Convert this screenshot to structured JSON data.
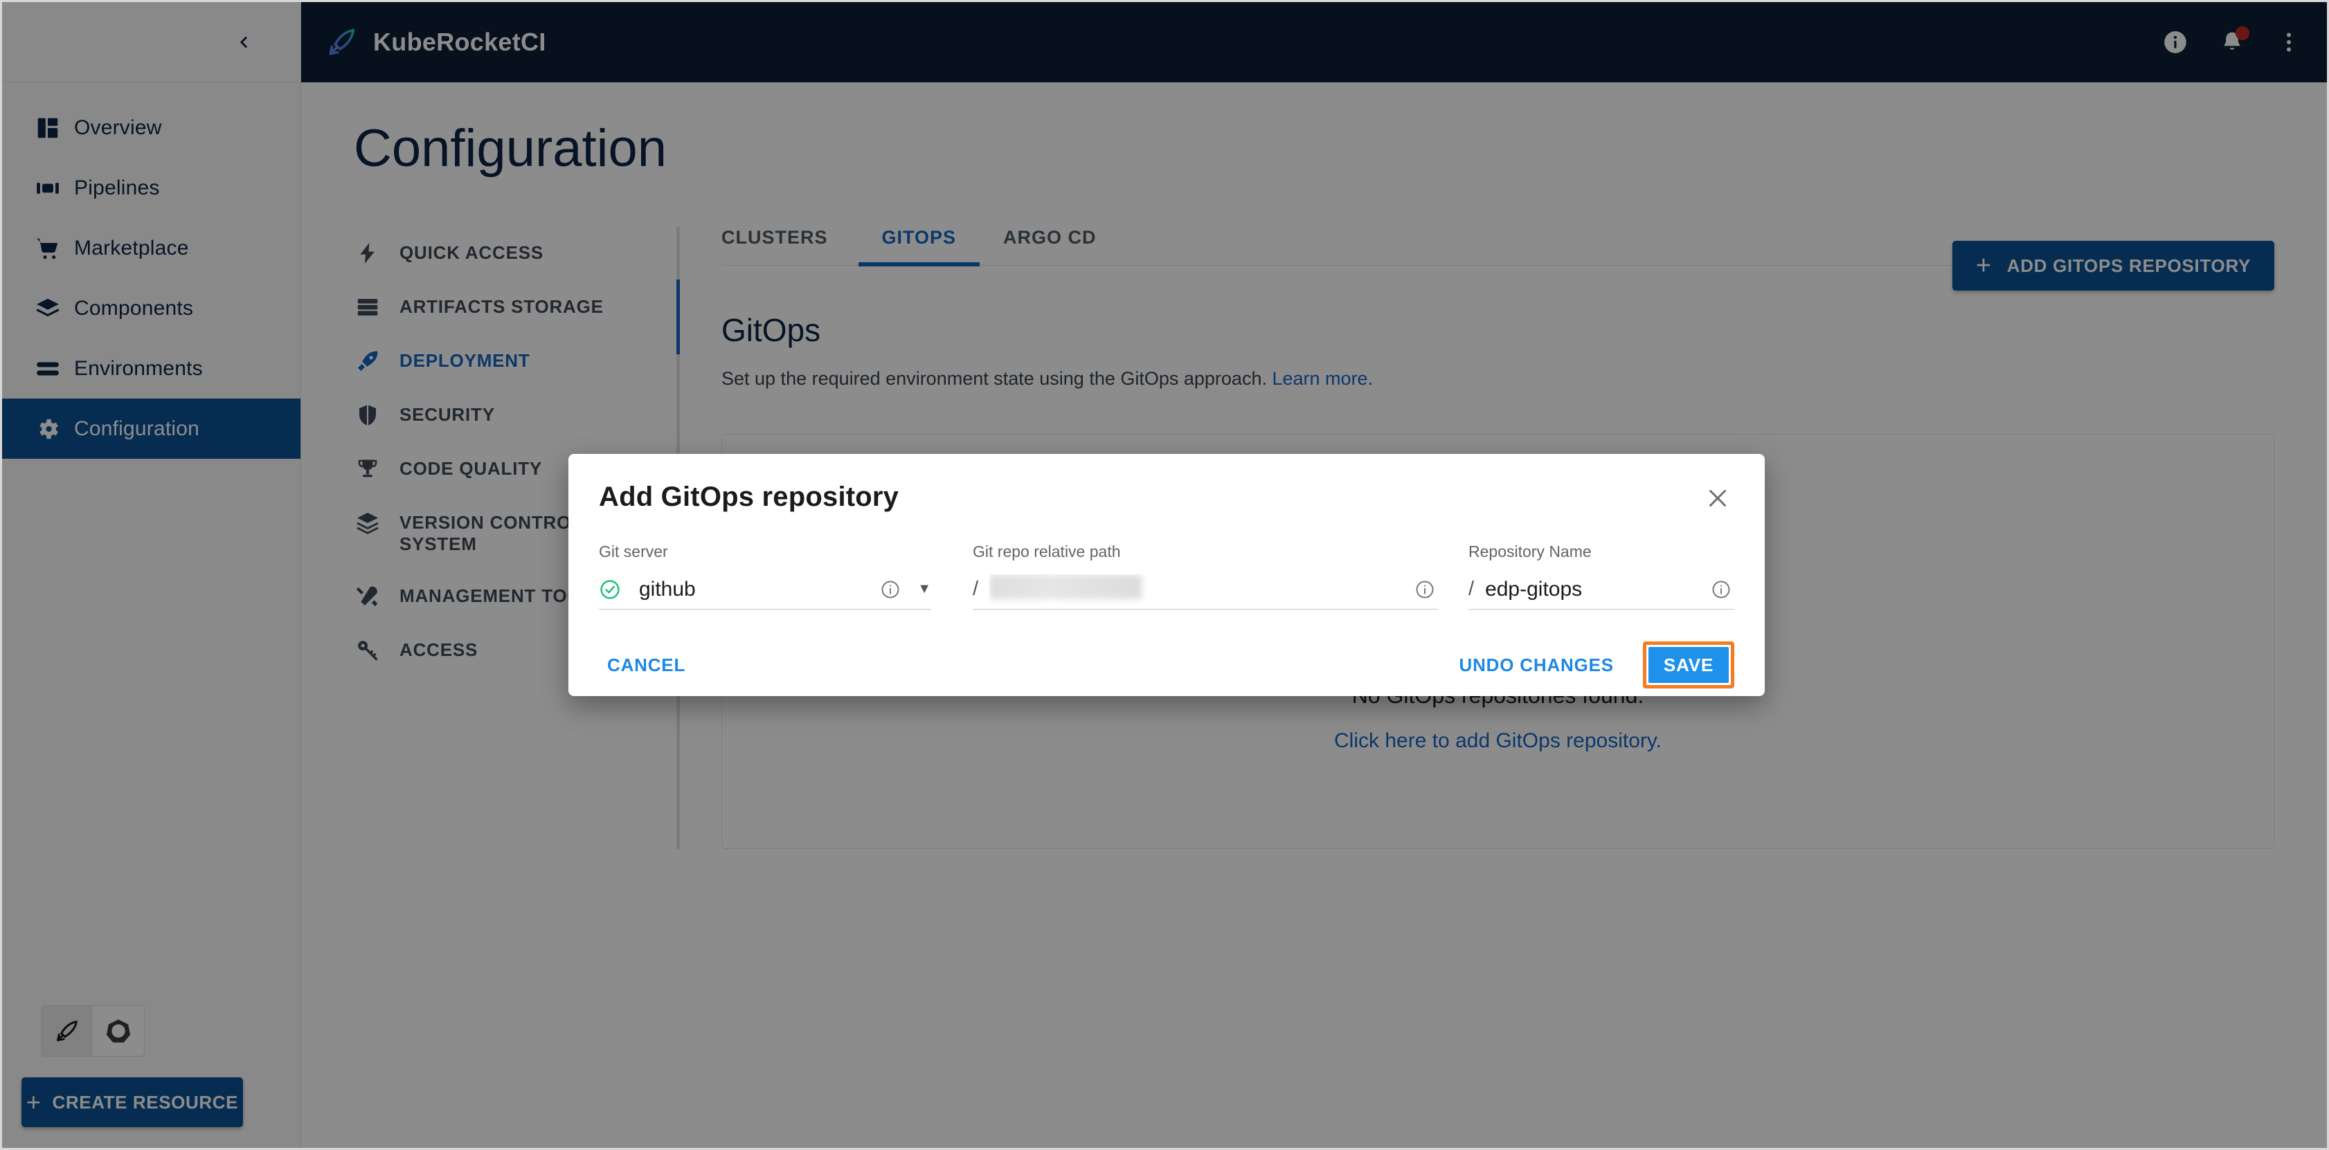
{
  "topbar": {
    "brand": "KubeRocketCI",
    "logo_icon": "rocket-feather-icon",
    "actions": [
      {
        "name": "info-icon",
        "label": "Info"
      },
      {
        "name": "notifications-bell-icon",
        "label": "Notifications",
        "badge": true
      },
      {
        "name": "more-vertical-icon",
        "label": "More options"
      }
    ]
  },
  "sidebar": {
    "collapse_icon": "chevron-left-icon",
    "items": [
      {
        "label": "Overview",
        "icon": "dashboard-icon",
        "active": false
      },
      {
        "label": "Pipelines",
        "icon": "pipelines-icon",
        "active": false
      },
      {
        "label": "Marketplace",
        "icon": "cart-icon",
        "active": false
      },
      {
        "label": "Components",
        "icon": "layers-icon",
        "active": false
      },
      {
        "label": "Environments",
        "icon": "stack-lines-icon",
        "active": false
      },
      {
        "label": "Configuration",
        "icon": "gear-icon",
        "active": true
      }
    ],
    "view_toggles": [
      {
        "name": "krci-view-toggle",
        "icon": "rocket-feather-icon",
        "selected": true
      },
      {
        "name": "kubernetes-view-toggle",
        "icon": "kubernetes-helm-icon",
        "selected": false
      }
    ],
    "create_resource_label": "CREATE RESOURCE",
    "create_resource_plus": "+"
  },
  "page": {
    "title": "Configuration"
  },
  "config_nav": {
    "items": [
      {
        "label": "QUICK ACCESS",
        "icon": "bolt-icon",
        "active": false
      },
      {
        "label": "ARTIFACTS STORAGE",
        "icon": "database-icon",
        "active": false
      },
      {
        "label": "DEPLOYMENT",
        "icon": "rocket-icon",
        "active": true
      },
      {
        "label": "SECURITY",
        "icon": "shield-icon",
        "active": false
      },
      {
        "label": "CODE QUALITY",
        "icon": "trophy-icon",
        "active": false
      },
      {
        "label": "VERSION CONTROL SYSTEM",
        "icon": "layers-icon",
        "active": false
      },
      {
        "label": "MANAGEMENT TOOLS",
        "icon": "tools-icon",
        "active": false
      },
      {
        "label": "ACCESS",
        "icon": "key-icon",
        "active": false
      }
    ]
  },
  "panel": {
    "tabs": [
      {
        "label": "CLUSTERS",
        "active": false
      },
      {
        "label": "GITOPS",
        "active": true
      },
      {
        "label": "ARGO CD",
        "active": false
      }
    ],
    "title": "GitOps",
    "description": "Set up the required environment state using the GitOps approach.",
    "learn_more": "Learn more.",
    "add_button_label": "ADD GITOPS REPOSITORY",
    "add_button_plus": "+",
    "empty_state": {
      "illustration_icon": "empty-box-icon",
      "title": "No GitOps repositories found.",
      "link": "Click here to add GitOps repository."
    }
  },
  "modal": {
    "title": "Add GitOps repository",
    "close_icon": "close-icon",
    "fields": [
      {
        "label": "Git server",
        "value": "github",
        "status_icon": "check-circle-icon",
        "status_color": "#21c07a",
        "info_icon": "info-circle-icon",
        "dropdown_icon": "caret-down-icon",
        "prefix": ""
      },
      {
        "label": "Git repo relative path",
        "value": "",
        "redacted": true,
        "info_icon": "info-circle-icon",
        "prefix": "/"
      },
      {
        "label": "Repository Name",
        "value": "edp-gitops",
        "info_icon": "info-circle-icon",
        "prefix": "/"
      }
    ],
    "cancel_label": "CANCEL",
    "undo_label": "UNDO CHANGES",
    "save_label": "SAVE",
    "save_highlight_color": "#f57c1f",
    "save_bg_color": "#1e91eb"
  }
}
